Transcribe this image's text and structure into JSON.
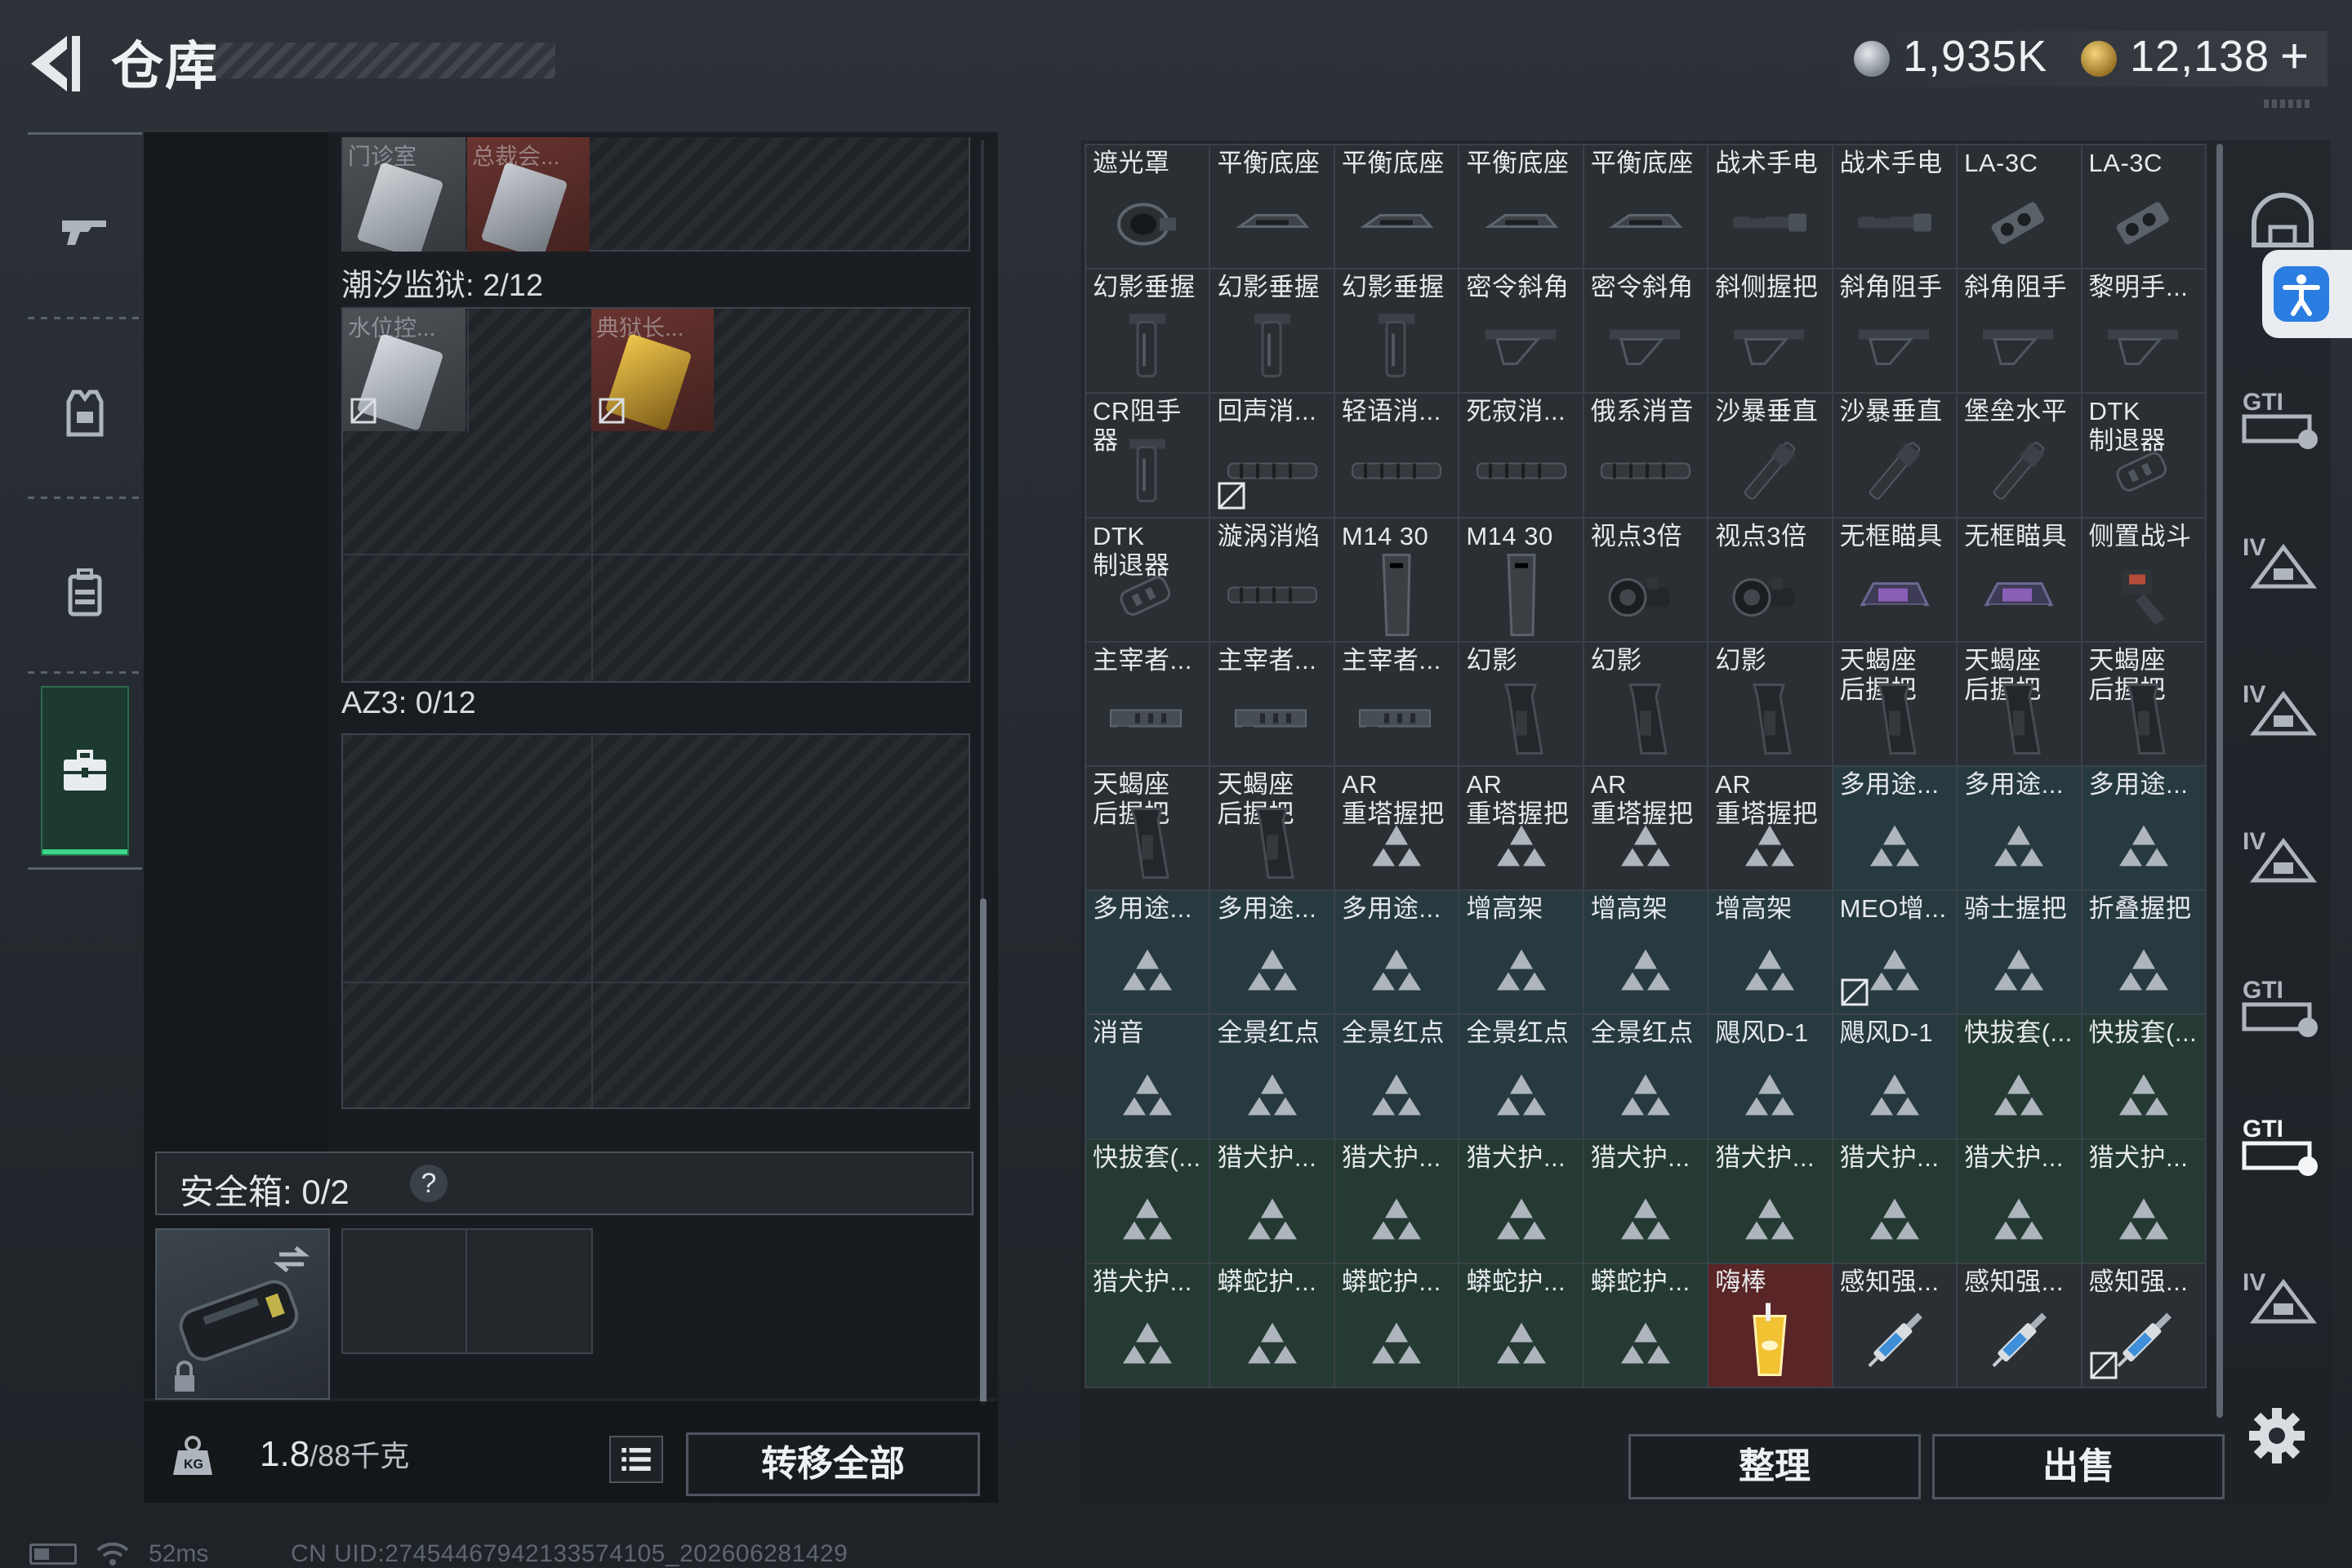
{
  "header": {
    "title": "仓库",
    "currency_silver": "1,935K",
    "currency_gold": "12,138",
    "plus_label": "+"
  },
  "left_nav": {
    "items": [
      {
        "name": "weapons",
        "icon": "gun-icon"
      },
      {
        "name": "armor",
        "icon": "vest-icon"
      },
      {
        "name": "backpack",
        "icon": "backpack-icon"
      },
      {
        "name": "toolbox",
        "icon": "toolbox-icon",
        "active": true
      }
    ]
  },
  "keys_panel": {
    "top_keys": [
      {
        "name": "门诊室",
        "color": "gray"
      },
      {
        "name": "总裁会...",
        "color": "red"
      }
    ],
    "section1_label": "潮汐监狱: 2/12",
    "section1_keys": [
      {
        "name": "水位控...",
        "color": "gray",
        "no_drop": true
      },
      {
        "name": "典狱长...",
        "color": "gold",
        "no_drop": true
      }
    ],
    "section2_label": "AZ3: 0/12"
  },
  "safe_box": {
    "label": "安全箱: 0/2",
    "help": "?"
  },
  "bottom_bar": {
    "weight_current": "1.8",
    "weight_max": "/88千克",
    "transfer_all": "转移全部"
  },
  "status": {
    "ping": "52ms",
    "uid": "CN UID:27454467942133574105_202606281429"
  },
  "warehouse": {
    "rows": [
      [
        {
          "name": "遮光罩",
          "tier": "gray",
          "icon": "lens-hood-icon"
        },
        {
          "name": "平衡底座",
          "tier": "gray",
          "icon": "mount-icon"
        },
        {
          "name": "平衡底座",
          "tier": "gray",
          "icon": "mount-icon"
        },
        {
          "name": "平衡底座",
          "tier": "gray",
          "icon": "mount-icon"
        },
        {
          "name": "平衡底座",
          "tier": "gray",
          "icon": "mount-icon"
        },
        {
          "name": "战术手电",
          "tier": "gray",
          "icon": "flashlight-icon"
        },
        {
          "name": "战术手电",
          "tier": "gray",
          "icon": "flashlight-icon"
        },
        {
          "name": "LA-3C",
          "tier": "gray",
          "icon": "laser-icon"
        },
        {
          "name": "LA-3C",
          "tier": "gray",
          "icon": "laser-icon"
        }
      ],
      [
        {
          "name": "幻影垂握",
          "tier": "gray",
          "icon": "vertical-grip-icon"
        },
        {
          "name": "幻影垂握",
          "tier": "gray",
          "icon": "vertical-grip-icon"
        },
        {
          "name": "幻影垂握",
          "tier": "gray",
          "icon": "vertical-grip-icon"
        },
        {
          "name": "密令斜角",
          "tier": "gray",
          "icon": "angled-grip-icon"
        },
        {
          "name": "密令斜角",
          "tier": "gray",
          "icon": "angled-grip-icon"
        },
        {
          "name": "斜侧握把",
          "tier": "gray",
          "icon": "angled-grip-icon"
        },
        {
          "name": "斜角阻手",
          "tier": "gray",
          "icon": "angled-grip-icon"
        },
        {
          "name": "斜角阻手",
          "tier": "gray",
          "icon": "angled-grip-icon"
        },
        {
          "name": "黎明手...",
          "tier": "gray",
          "icon": "angled-grip-icon"
        }
      ],
      [
        {
          "name": "CR阻手器",
          "tier": "gray",
          "icon": "vertical-grip-icon"
        },
        {
          "name": "回声消...",
          "tier": "gray",
          "icon": "suppressor-icon",
          "no_drop": true
        },
        {
          "name": "轻语消...",
          "tier": "gray",
          "icon": "suppressor-icon"
        },
        {
          "name": "死寂消...",
          "tier": "gray",
          "icon": "suppressor-icon"
        },
        {
          "name": "俄系消音",
          "tier": "gray",
          "icon": "suppressor-icon"
        },
        {
          "name": "沙暴垂直",
          "tier": "gray",
          "icon": "barrel-icon"
        },
        {
          "name": "沙暴垂直",
          "tier": "gray",
          "icon": "barrel-icon"
        },
        {
          "name": "堡垒水平",
          "tier": "gray",
          "icon": "barrel-icon"
        },
        {
          "name": "DTK\n制退器",
          "tier": "gray",
          "icon": "muzzle-brake-icon"
        }
      ],
      [
        {
          "name": "DTK\n制退器",
          "tier": "gray",
          "icon": "muzzle-brake-icon"
        },
        {
          "name": "漩涡消焰",
          "tier": "gray",
          "icon": "suppressor-icon"
        },
        {
          "name": "M14 30",
          "tier": "gray",
          "icon": "magazine-icon"
        },
        {
          "name": "M14 30",
          "tier": "gray",
          "icon": "magazine-icon"
        },
        {
          "name": "视点3倍",
          "tier": "gray",
          "icon": "scope-icon"
        },
        {
          "name": "视点3倍",
          "tier": "gray",
          "icon": "scope-icon"
        },
        {
          "name": "无框瞄具",
          "tier": "gray",
          "icon": "holo-sight-icon"
        },
        {
          "name": "无框瞄具",
          "tier": "gray",
          "icon": "holo-sight-icon"
        },
        {
          "name": "侧置战斗",
          "tier": "gray",
          "icon": "side-sight-icon"
        }
      ],
      [
        {
          "name": "主宰者...",
          "tier": "gray",
          "icon": "handguard-icon"
        },
        {
          "name": "主宰者...",
          "tier": "gray",
          "icon": "handguard-icon"
        },
        {
          "name": "主宰者...",
          "tier": "gray",
          "icon": "handguard-icon"
        },
        {
          "name": "幻影",
          "tier": "gray",
          "icon": "pistol-grip-icon"
        },
        {
          "name": "幻影",
          "tier": "gray",
          "icon": "pistol-grip-icon"
        },
        {
          "name": "幻影",
          "tier": "gray",
          "icon": "pistol-grip-icon"
        },
        {
          "name": "天蝎座\n后握把",
          "tier": "gray",
          "icon": "pistol-grip-icon"
        },
        {
          "name": "天蝎座\n后握把",
          "tier": "gray",
          "icon": "pistol-grip-icon"
        },
        {
          "name": "天蝎座\n后握把",
          "tier": "gray",
          "icon": "pistol-grip-icon"
        }
      ],
      [
        {
          "name": "天蝎座\n后握把",
          "tier": "gray",
          "icon": "pistol-grip-icon"
        },
        {
          "name": "天蝎座\n后握把",
          "tier": "gray",
          "icon": "pistol-grip-icon"
        },
        {
          "name": "AR\n重塔握把",
          "tier": "gray",
          "icon": "triangle-placeholder-icon"
        },
        {
          "name": "AR\n重塔握把",
          "tier": "gray",
          "icon": "triangle-placeholder-icon"
        },
        {
          "name": "AR\n重塔握把",
          "tier": "gray",
          "icon": "triangle-placeholder-icon"
        },
        {
          "name": "AR\n重塔握把",
          "tier": "gray",
          "icon": "triangle-placeholder-icon"
        },
        {
          "name": "多用途...",
          "tier": "teal",
          "icon": "triangle-placeholder-icon"
        },
        {
          "name": "多用途...",
          "tier": "teal",
          "icon": "triangle-placeholder-icon"
        },
        {
          "name": "多用途...",
          "tier": "teal",
          "icon": "triangle-placeholder-icon"
        }
      ],
      [
        {
          "name": "多用途...",
          "tier": "teal",
          "icon": "triangle-placeholder-icon"
        },
        {
          "name": "多用途...",
          "tier": "teal",
          "icon": "triangle-placeholder-icon"
        },
        {
          "name": "多用途...",
          "tier": "teal",
          "icon": "triangle-placeholder-icon"
        },
        {
          "name": "增高架",
          "tier": "teal",
          "icon": "triangle-placeholder-icon"
        },
        {
          "name": "增高架",
          "tier": "teal",
          "icon": "triangle-placeholder-icon"
        },
        {
          "name": "增高架",
          "tier": "teal",
          "icon": "triangle-placeholder-icon"
        },
        {
          "name": "MEO增...",
          "tier": "teal",
          "icon": "triangle-placeholder-icon",
          "no_drop": true
        },
        {
          "name": "骑士握把",
          "tier": "teal",
          "icon": "triangle-placeholder-icon"
        },
        {
          "name": "折叠握把",
          "tier": "teal",
          "icon": "triangle-placeholder-icon"
        }
      ],
      [
        {
          "name": "消音",
          "tier": "teal",
          "icon": "triangle-placeholder-icon"
        },
        {
          "name": "全景红点",
          "tier": "teal",
          "icon": "triangle-placeholder-icon"
        },
        {
          "name": "全景红点",
          "tier": "teal",
          "icon": "triangle-placeholder-icon"
        },
        {
          "name": "全景红点",
          "tier": "teal",
          "icon": "triangle-placeholder-icon"
        },
        {
          "name": "全景红点",
          "tier": "teal",
          "icon": "triangle-placeholder-icon"
        },
        {
          "name": "飓风D-1",
          "tier": "teal",
          "icon": "triangle-placeholder-icon"
        },
        {
          "name": "飓风D-1",
          "tier": "teal",
          "icon": "triangle-placeholder-icon"
        },
        {
          "name": "快拔套(...",
          "tier": "green",
          "icon": "triangle-placeholder-icon"
        },
        {
          "name": "快拔套(...",
          "tier": "green",
          "icon": "triangle-placeholder-icon"
        }
      ],
      [
        {
          "name": "快拔套(...",
          "tier": "green",
          "icon": "triangle-placeholder-icon"
        },
        {
          "name": "猎犬护...",
          "tier": "green",
          "icon": "triangle-placeholder-icon"
        },
        {
          "name": "猎犬护...",
          "tier": "green",
          "icon": "triangle-placeholder-icon"
        },
        {
          "name": "猎犬护...",
          "tier": "green",
          "icon": "triangle-placeholder-icon"
        },
        {
          "name": "猎犬护...",
          "tier": "green",
          "icon": "triangle-placeholder-icon"
        },
        {
          "name": "猎犬护...",
          "tier": "green",
          "icon": "triangle-placeholder-icon"
        },
        {
          "name": "猎犬护...",
          "tier": "green",
          "icon": "triangle-placeholder-icon"
        },
        {
          "name": "猎犬护...",
          "tier": "green",
          "icon": "triangle-placeholder-icon"
        },
        {
          "name": "猎犬护...",
          "tier": "green",
          "icon": "triangle-placeholder-icon"
        }
      ],
      [
        {
          "name": "猎犬护...",
          "tier": "green",
          "icon": "triangle-placeholder-icon"
        },
        {
          "name": "蟒蛇护...",
          "tier": "green",
          "icon": "triangle-placeholder-icon"
        },
        {
          "name": "蟒蛇护...",
          "tier": "green",
          "icon": "triangle-placeholder-icon"
        },
        {
          "name": "蟒蛇护...",
          "tier": "green",
          "icon": "triangle-placeholder-icon"
        },
        {
          "name": "蟒蛇护...",
          "tier": "green",
          "icon": "triangle-placeholder-icon"
        },
        {
          "name": "嗨棒",
          "tier": "red",
          "icon": "drink-icon"
        },
        {
          "name": "感知强...",
          "tier": "gray",
          "icon": "syringe-icon"
        },
        {
          "name": "感知强...",
          "tier": "gray",
          "icon": "syringe-icon"
        },
        {
          "name": "感知强...",
          "tier": "gray",
          "icon": "syringe-icon",
          "no_drop": true
        }
      ]
    ]
  },
  "actions": {
    "sort": "整理",
    "sell": "出售"
  },
  "right_rail": {
    "items": [
      {
        "name": "helmet-filter",
        "icon": "helmet-icon"
      },
      {
        "name": "gti-filter-1",
        "icon": "gti-badge-icon"
      },
      {
        "name": "iv-filter-1",
        "icon": "iv-badge-icon"
      },
      {
        "name": "iv-filter-2",
        "icon": "iv-badge-icon"
      },
      {
        "name": "iv-filter-3",
        "icon": "iv-badge-icon"
      },
      {
        "name": "gti-filter-2",
        "icon": "gti-badge-icon"
      },
      {
        "name": "gti-filter-3",
        "icon": "gti-badge-icon",
        "active": true
      },
      {
        "name": "iv-filter-4",
        "icon": "iv-badge-icon"
      }
    ]
  },
  "colors": {
    "accent_green": "#3cd68a",
    "tier_teal": "#273a40",
    "tier_green": "#243a33",
    "tier_red": "#5a2526",
    "access_blue": "#2a7de1"
  }
}
